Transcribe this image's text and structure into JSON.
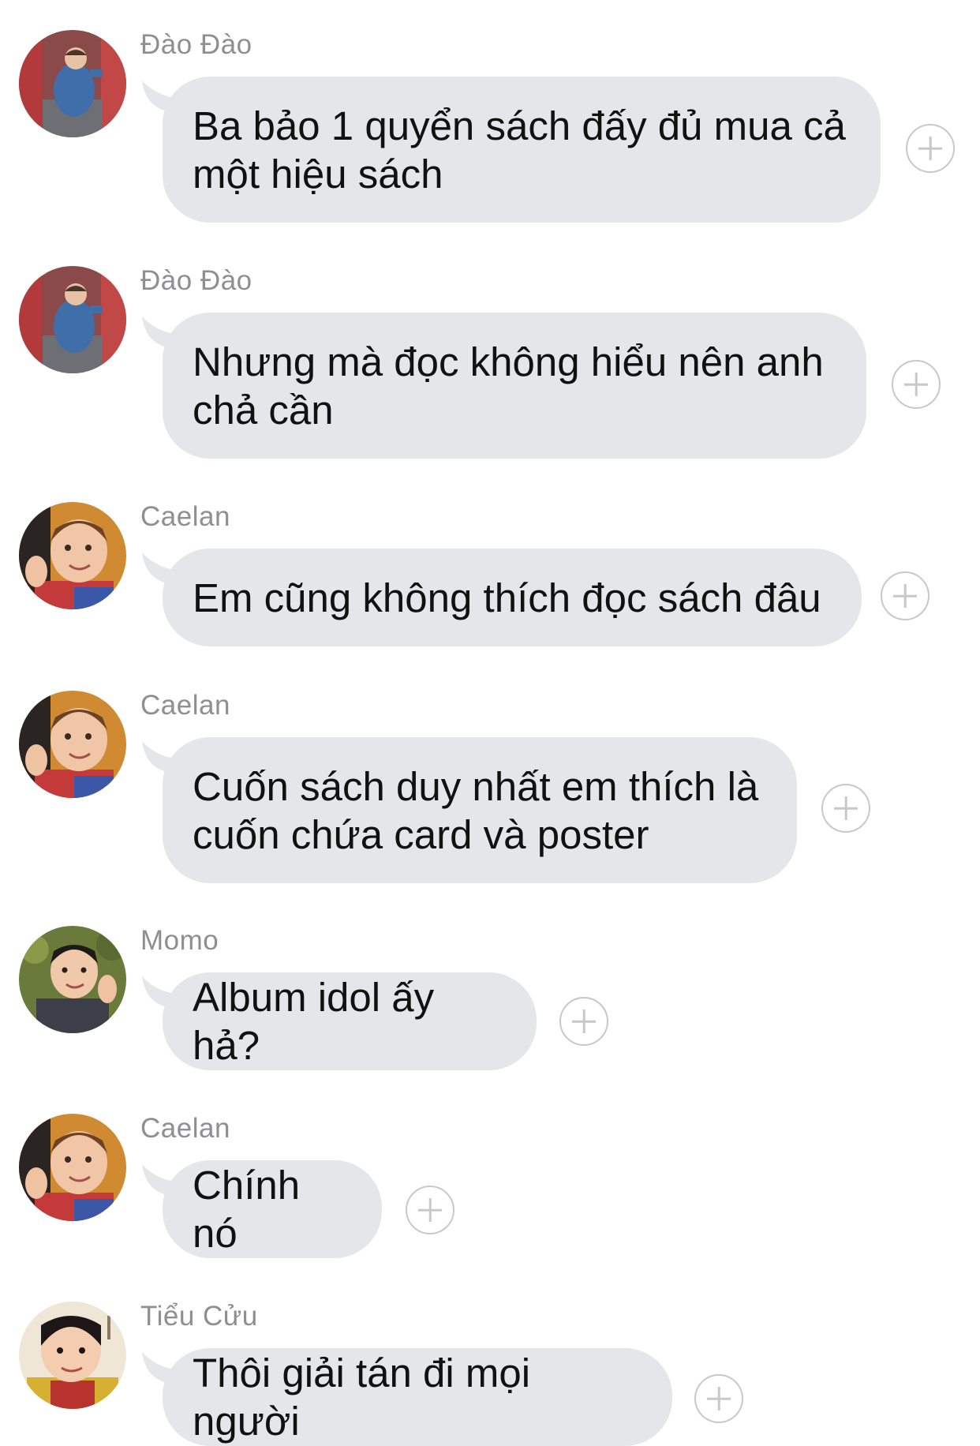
{
  "messages": [
    {
      "sender": "Đào Đào",
      "avatar": "dao-dao",
      "lines": [
        "Ba bảo 1 quyển sách đấy đủ mua cả",
        "một hiệu sách"
      ]
    },
    {
      "sender": "Đào Đào",
      "avatar": "dao-dao",
      "lines": [
        "Nhưng mà đọc không hiểu nên anh",
        "chả cần"
      ]
    },
    {
      "sender": "Caelan",
      "avatar": "caelan",
      "lines": [
        "Em cũng không thích đọc sách đâu"
      ]
    },
    {
      "sender": "Caelan",
      "avatar": "caelan",
      "lines": [
        "Cuốn sách duy nhất em thích là",
        "cuốn chứa card và poster"
      ]
    },
    {
      "sender": "Momo",
      "avatar": "momo",
      "lines": [
        "Album idol ấy hả?"
      ]
    },
    {
      "sender": "Caelan",
      "avatar": "caelan",
      "lines": [
        "Chính nó"
      ]
    },
    {
      "sender": "Tiểu Cửu",
      "avatar": "tieu-cuu",
      "lines": [
        "Thôi giải tán đi mọi người"
      ]
    }
  ],
  "icons": {
    "reaction": "add-reaction-icon"
  },
  "colors": {
    "bubble": "#e5e6e9",
    "sender_name": "#8e8e93",
    "message_text": "#111111",
    "reaction_icon": "#c8c8cc"
  }
}
